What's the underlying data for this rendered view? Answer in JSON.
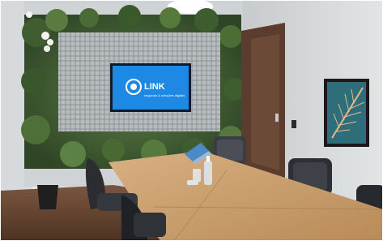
{
  "photo": {
    "subject": "conference-room",
    "tv_screen": {
      "brand": "LINK",
      "tagline": "negócios & soluções digitais",
      "screen_color": "#1e88e5"
    },
    "colors": {
      "wall_left": "#d9dde0",
      "wall_right": "#d4d8da",
      "door": "#5a3d2e",
      "table": "#c9a06e",
      "floor": "#6b4a35",
      "plants": "#4b6b3a",
      "checker_panel": "#a9aeb1",
      "chair": "#2c2f33"
    }
  }
}
